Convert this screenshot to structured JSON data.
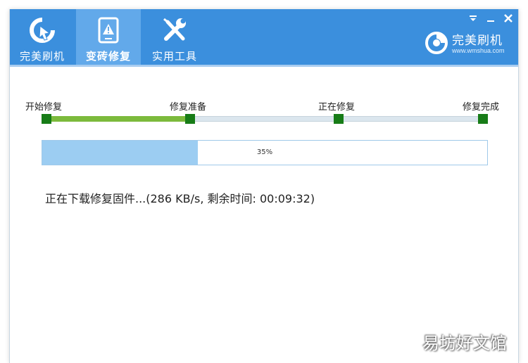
{
  "tabs": [
    {
      "label": "完美刷机",
      "icon": "refresh-arrow-icon",
      "active": false
    },
    {
      "label": "变砖修复",
      "icon": "tablet-warning-icon",
      "active": true
    },
    {
      "label": "实用工具",
      "icon": "wrench-screwdriver-icon",
      "active": false
    }
  ],
  "window_controls": {
    "menu_icon": "dropdown-menu-icon",
    "minimize_icon": "minimize-icon",
    "close_icon": "close-icon"
  },
  "brand": {
    "name": "完美刷机",
    "url": "www.wmshua.com",
    "logo": "brand-logo-icon"
  },
  "steps": [
    {
      "label": "开始修复"
    },
    {
      "label": "修复准备"
    },
    {
      "label": "正在修复"
    },
    {
      "label": "修复完成"
    }
  ],
  "step_progress": {
    "completed_fraction": 0.33
  },
  "progress": {
    "percent": 35,
    "label": "35%"
  },
  "status": {
    "text": "正在下载修复固件...(286 KB/s, 剩余时间: 00:09:32)"
  },
  "watermark": {
    "text": "易坊好文馆"
  },
  "colors": {
    "header": "#3b8fdd",
    "active_tab": "#62a9ea",
    "step_fill": "#7cba3c",
    "step_marker": "#177c17",
    "progress_fill": "#9ccdf2"
  }
}
